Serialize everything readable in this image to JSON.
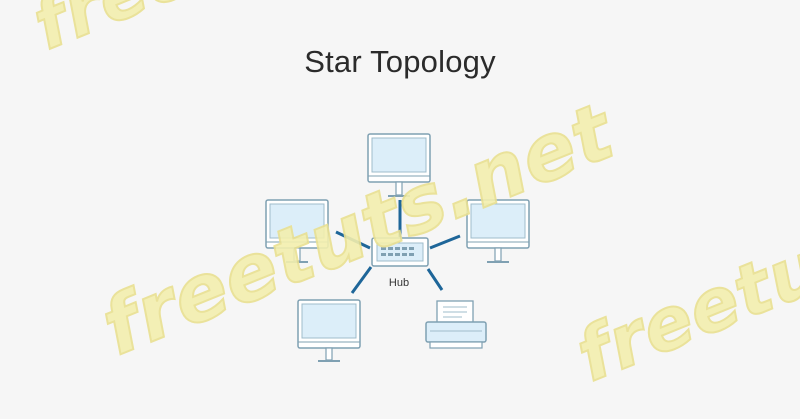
{
  "diagram": {
    "title": "Star Topology",
    "hub_label": "Hub",
    "nodes": [
      "monitor-top",
      "monitor-left",
      "monitor-right",
      "monitor-bottom-left",
      "printer"
    ]
  },
  "watermark": {
    "text": "freetuts.net"
  },
  "colors": {
    "background": "#f6f6f6",
    "device_outline": "#7fa0b2",
    "screen_fill": "#dceef9",
    "link_line": "#1e6699",
    "title_text": "#2b2b2b"
  }
}
